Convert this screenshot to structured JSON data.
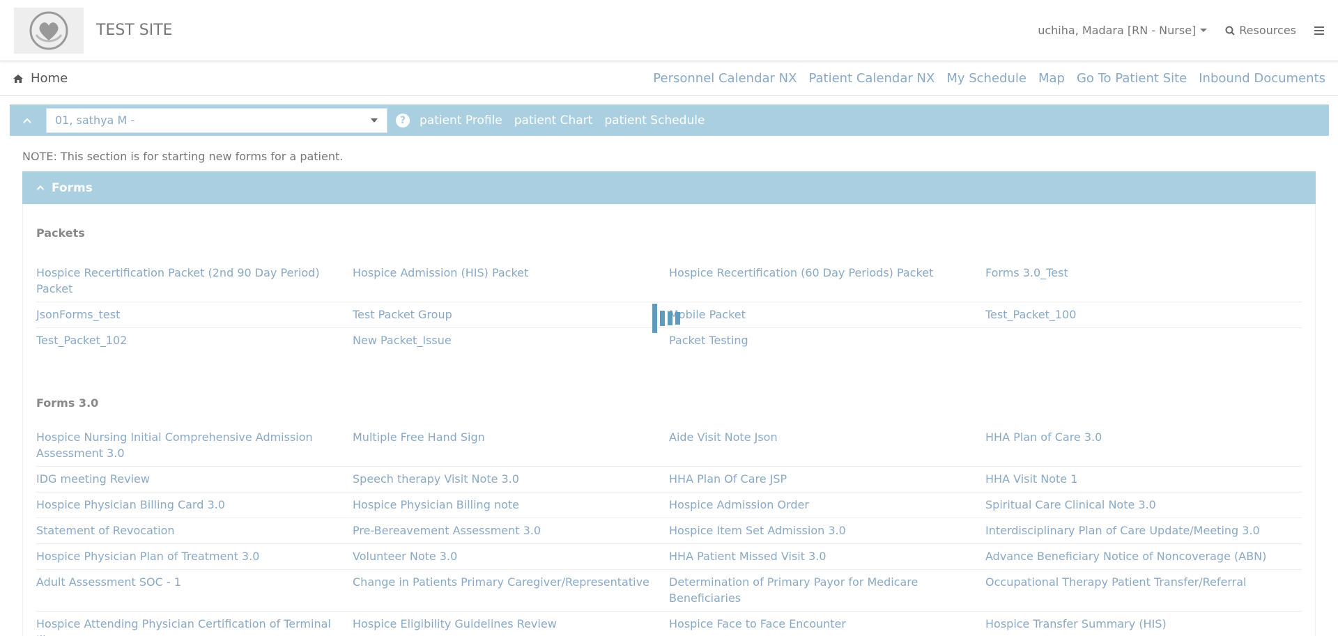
{
  "header": {
    "site_title": "TEST SITE",
    "user_label": "uchiha, Madara [RN - Nurse]",
    "resources_label": "Resources"
  },
  "nav": {
    "home_label": "Home",
    "links": [
      "Personnel Calendar NX",
      "Patient Calendar NX",
      "My Schedule",
      "Map",
      "Go To Patient Site",
      "Inbound Documents"
    ]
  },
  "patient_bar": {
    "selected_patient": "01, sathya M -",
    "links": [
      "patient Profile",
      "patient Chart",
      "patient Schedule"
    ]
  },
  "note": "NOTE: This section is for starting new forms for a patient.",
  "forms": {
    "title": "Forms",
    "packets_title": "Packets",
    "packets": [
      [
        "Hospice Recertification Packet (2nd 90 Day Period) Packet",
        "Hospice Admission (HIS) Packet",
        "Hospice Recertification (60 Day Periods) Packet",
        "Forms 3.0_Test"
      ],
      [
        "JsonForms_test",
        "Test Packet Group",
        "Mobile Packet",
        "Test_Packet_100"
      ],
      [
        "Test_Packet_102",
        "New Packet_Issue",
        "Packet Testing",
        ""
      ]
    ],
    "forms30_title": "Forms 3.0",
    "forms30": [
      [
        "Hospice Nursing Initial Comprehensive Admission Assessment 3.0",
        "Multiple Free Hand Sign",
        "Aide Visit Note Json",
        "HHA Plan of Care 3.0"
      ],
      [
        "IDG meeting Review",
        "Speech therapy Visit Note 3.0",
        "HHA Plan Of Care JSP",
        "HHA Visit Note 1"
      ],
      [
        "Hospice Physician Billing Card 3.0",
        "Hospice Physician Billing note",
        "Hospice Admission Order",
        "Spiritual Care Clinical Note 3.0"
      ],
      [
        "Statement of Revocation",
        "Pre-Bereavement Assessment 3.0",
        "Hospice Item Set Admission 3.0",
        "Interdisciplinary Plan of Care Update/Meeting 3.0"
      ],
      [
        "Hospice Physician Plan of Treatment 3.0",
        "Volunteer Note 3.0",
        "HHA Patient Missed Visit 3.0",
        "Advance Beneficiary Notice of Noncoverage (ABN)"
      ],
      [
        "Adult Assessment SOC - 1",
        "Change in Patients Primary Caregiver/Representative",
        "Determination of Primary Payor for Medicare Beneficiaries",
        "Occupational Therapy Patient Transfer/Referral"
      ],
      [
        "Hospice Attending Physician Certification of Terminal Illness",
        "Hospice Eligibility Guidelines Review",
        "Hospice Face to Face Encounter",
        "Hospice Transfer Summary (HIS)"
      ]
    ]
  },
  "colors": {
    "accent": "#a9cfe0",
    "link": "#8aa9c6"
  }
}
